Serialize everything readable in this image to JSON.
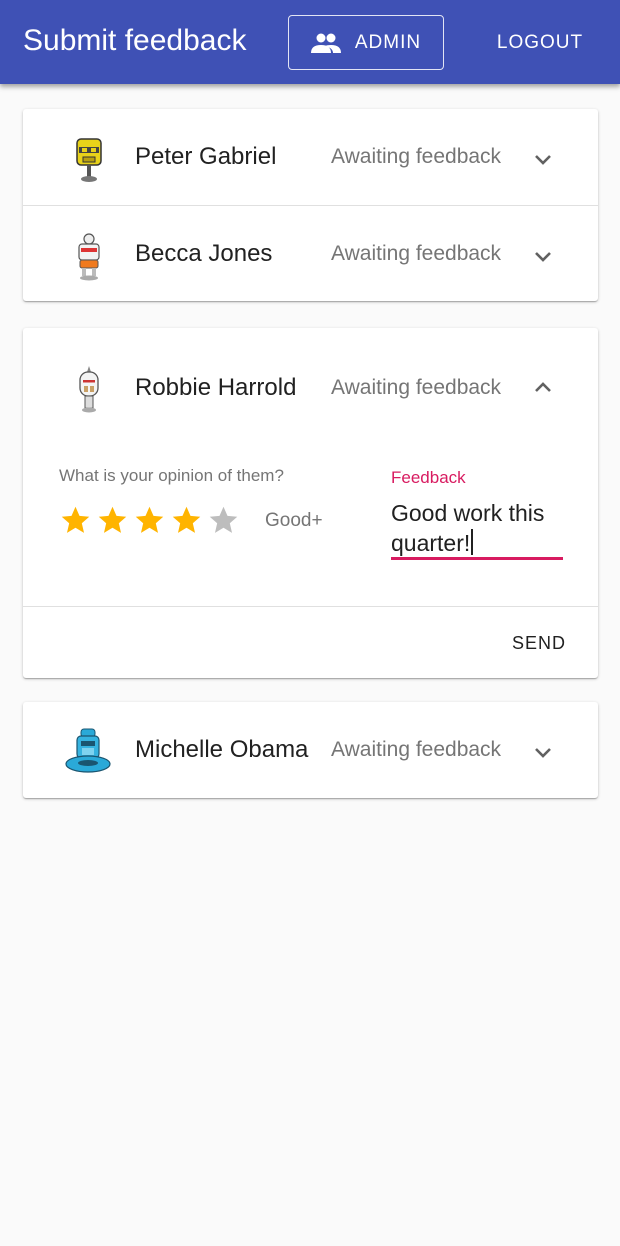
{
  "appbar": {
    "title": "Submit feedback",
    "admin_label": "ADMIN",
    "admin_icon": "people-icon",
    "logout_label": "LOGOUT",
    "color": "#3f51b5"
  },
  "people": [
    {
      "name": "Peter Gabriel",
      "status": "Awaiting feedback",
      "expanded": false,
      "avatar": "yellow-robot"
    },
    {
      "name": "Becca Jones",
      "status": "Awaiting feedback",
      "expanded": false,
      "avatar": "white-orange-robot"
    },
    {
      "name": "Robbie Harrold",
      "status": "Awaiting feedback",
      "expanded": true,
      "avatar": "white-robot"
    },
    {
      "name": "Michelle Obama",
      "status": "Awaiting feedback",
      "expanded": false,
      "avatar": "blue-robot"
    }
  ],
  "feedback_form": {
    "question": "What is your opinion of them?",
    "rating": 4,
    "max_rating": 5,
    "rating_label": "Good+",
    "field_label": "Feedback",
    "field_value": "Good work this quarter!",
    "send_label": "SEND",
    "accent_color": "#d81b60",
    "star_color": "#ffb400"
  }
}
